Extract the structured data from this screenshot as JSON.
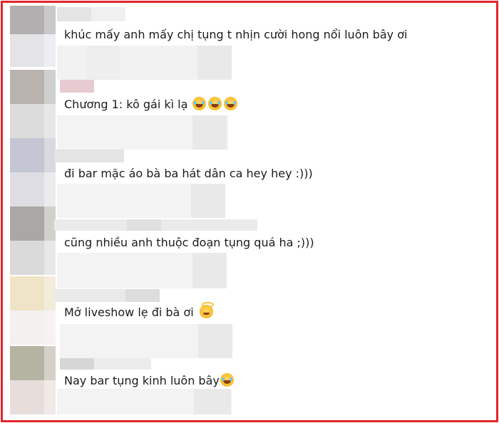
{
  "comments": [
    {
      "text": "khúc mấy anh mấy chị tụng t nhịn cười hong nổi luôn bây ơi",
      "emojis": []
    },
    {
      "text": "Chương 1: kô gái kì lạ",
      "emojis": [
        "laughing-tears-emoji",
        "laughing-tears-emoji",
        "laughing-tears-emoji"
      ]
    },
    {
      "text": "đi bar mặc áo bà ba hát dân ca hey hey :)))",
      "emojis": []
    },
    {
      "text": "cũng nhiều anh thuộc đoạn tụng quá ha ;)))",
      "emojis": []
    },
    {
      "text": "Mở liveshow lẹ đi bà ơi",
      "emojis": [
        "smiling-halo-emoji"
      ]
    },
    {
      "text": "Nay bar tụng kinh luôn bây",
      "emojis": [
        "laughing-tears-emoji"
      ]
    }
  ],
  "colors": {
    "border": "#e3262b",
    "text": "#1c1c1c",
    "pixel_light": "#efefef",
    "pixel_mid": "#e2e2e2"
  }
}
